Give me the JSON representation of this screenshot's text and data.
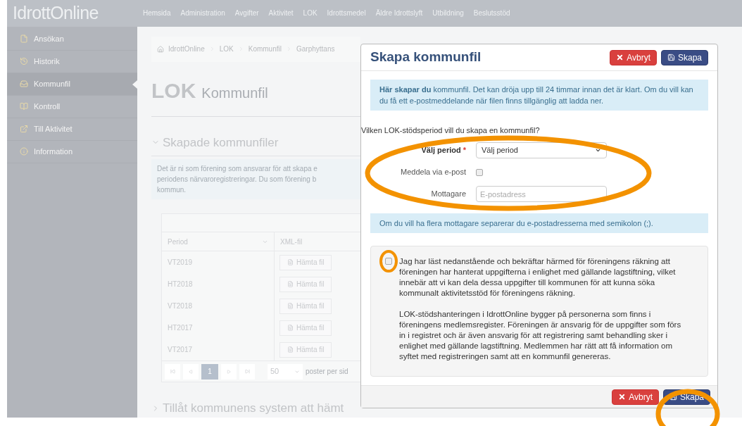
{
  "topbar": {
    "logo": "IdrottOnline",
    "nav": [
      "Hemsida",
      "Administration",
      "Avgifter",
      "Aktivitet",
      "LOK",
      "Idrottsmedel",
      "Äldre Idrottslyft",
      "Utbildning",
      "Beslutsstöd"
    ]
  },
  "sidebar": {
    "items": [
      {
        "label": "Ansökan",
        "selected": false
      },
      {
        "label": "Historik",
        "selected": false
      },
      {
        "label": "Kommunfil",
        "selected": true
      },
      {
        "label": "Kontroll",
        "selected": false
      },
      {
        "label": "Till Aktivitet",
        "selected": false
      },
      {
        "label": "Information",
        "selected": false
      }
    ]
  },
  "breadcrumb": [
    "IdrottOnline",
    "LOK",
    "Kommunfil",
    "Garphyttans"
  ],
  "page_title": {
    "main": "LOK",
    "sub": "Kommunfil"
  },
  "section": {
    "title": "Skapade kommunfiler",
    "info_lines": [
      "Det är ni som förening som ansvarar för att skapa e",
      "periodens närvaroregistreringar. Du som förening b",
      "kommun."
    ]
  },
  "table": {
    "columns": [
      "Period",
      "XML-fil"
    ],
    "rows": [
      {
        "period": "VT2019",
        "action": "Hämta fil"
      },
      {
        "period": "HT2018",
        "action": "Hämta fil"
      },
      {
        "period": "VT2018",
        "action": "Hämta fil"
      },
      {
        "period": "HT2017",
        "action": "Hämta fil"
      },
      {
        "period": "VT2017",
        "action": "Hämta fil"
      }
    ],
    "pagination": {
      "pages": [
        {
          "label": "1",
          "selected": true
        }
      ],
      "page_size": "50",
      "page_size_label": "poster per sid"
    }
  },
  "section2": {
    "title": "Tillåt kommunens system att hämt"
  },
  "modal": {
    "title": "Skapa kommunfil",
    "cancel": "Avbryt",
    "create": "Skapa",
    "intro": "**Här skapar du** kommunfil. Det kan dröja upp till 24 timmar innan det är klart. Om du vill kan du få ett e-postmeddelande när filen finns tillgänglig att ladda ner.",
    "question": "Vilken LOK-stödsperiod vill du skapa en kommunfil?",
    "period": {
      "label": "Välj period",
      "required_mark": "*",
      "value": "Välj period"
    },
    "notify": {
      "label": "Meddela via e-post",
      "checked": false
    },
    "recipient": {
      "label": "Mottagare",
      "placeholder": "E-postadress"
    },
    "hint": "Om du vill ha flera mottagare separerar du e-postadresserna med semikolon (;).",
    "consent": {
      "checked": false,
      "paragraphs": [
        "Jag har läst nedanstående och bekräftar härmed för föreningens räkning att föreningen har hanterat uppgifterna i enlighet med gällande lagstiftning, vilket innebär att vi kan dela dessa uppgifter till kommunen för att kunna söka kommunalt aktivitetsstöd för föreningens räkning.",
        "LOK-stödshanteringen i IdrottOnline bygger på personerna som finns i föreningens medlemsregister. Föreningen är ansvarig för de uppgifter som förs in i registret och är även ansvarig för att registrering samt behandling sker i enlighet med gällande lagstiftning. Medlemmen har rätt att få information om syftet med registreringen samt att en kommunfil genereras."
      ]
    },
    "footer": {
      "cancel": "Avbryt",
      "create": "Skapa"
    }
  }
}
